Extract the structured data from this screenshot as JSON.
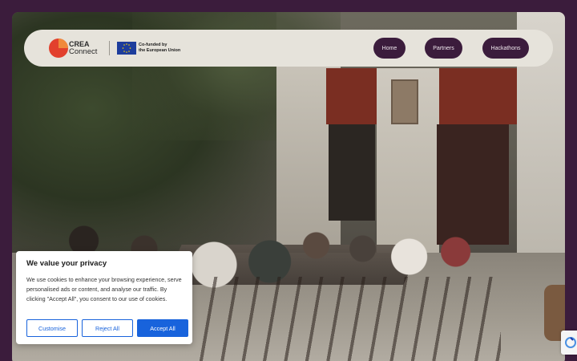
{
  "header": {
    "brand_line1": "CREA",
    "brand_line2": "Connect",
    "eu_text_line1": "Co-funded by",
    "eu_text_line2": "the European Union",
    "nav": [
      {
        "label": "Home"
      },
      {
        "label": "Partners"
      },
      {
        "label": "Hackathons"
      }
    ]
  },
  "cookie": {
    "title": "We value your privacy",
    "body": "We use cookies to enhance your browsing experience, serve personalised ads or content, and analyse our traffic. By clicking \"Accept All\", you consent to our use of cookies.",
    "customise": "Customise",
    "reject": "Reject All",
    "accept": "Accept All"
  },
  "colors": {
    "page_bg": "#3b1c3c",
    "nav_button": "#3b1c3c",
    "header_bg": "#e6e3db",
    "cookie_accent": "#1863dc",
    "logo_red": "#e2402d"
  },
  "icons": {
    "logo": "crea-connect-logo",
    "eu_flag": "eu-flag-icon",
    "recaptcha": "recaptcha-icon"
  }
}
